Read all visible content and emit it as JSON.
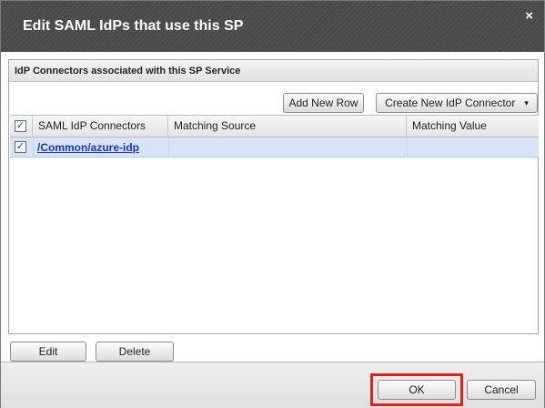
{
  "dialog": {
    "title": "Edit SAML IdPs that use this SP",
    "close_glyph": "×"
  },
  "section": {
    "header": "IdP Connectors associated with this SP Service",
    "add_row_label": "Add New Row",
    "create_connector_label": "Create New IdP Connector",
    "create_connector_caret": "▾"
  },
  "table": {
    "columns": [
      "SAML IdP Connectors",
      "Matching Source",
      "Matching Value"
    ],
    "header_checked": true,
    "rows": [
      {
        "checked": true,
        "connector": "/Common/azure-idp",
        "source": "",
        "value": ""
      }
    ]
  },
  "bottom_buttons": {
    "edit_label": "Edit",
    "delete_label": "Delete"
  },
  "footer": {
    "ok_label": "OK",
    "cancel_label": "Cancel",
    "highlight_color": "#e0201c"
  },
  "check_glyph": "✓"
}
